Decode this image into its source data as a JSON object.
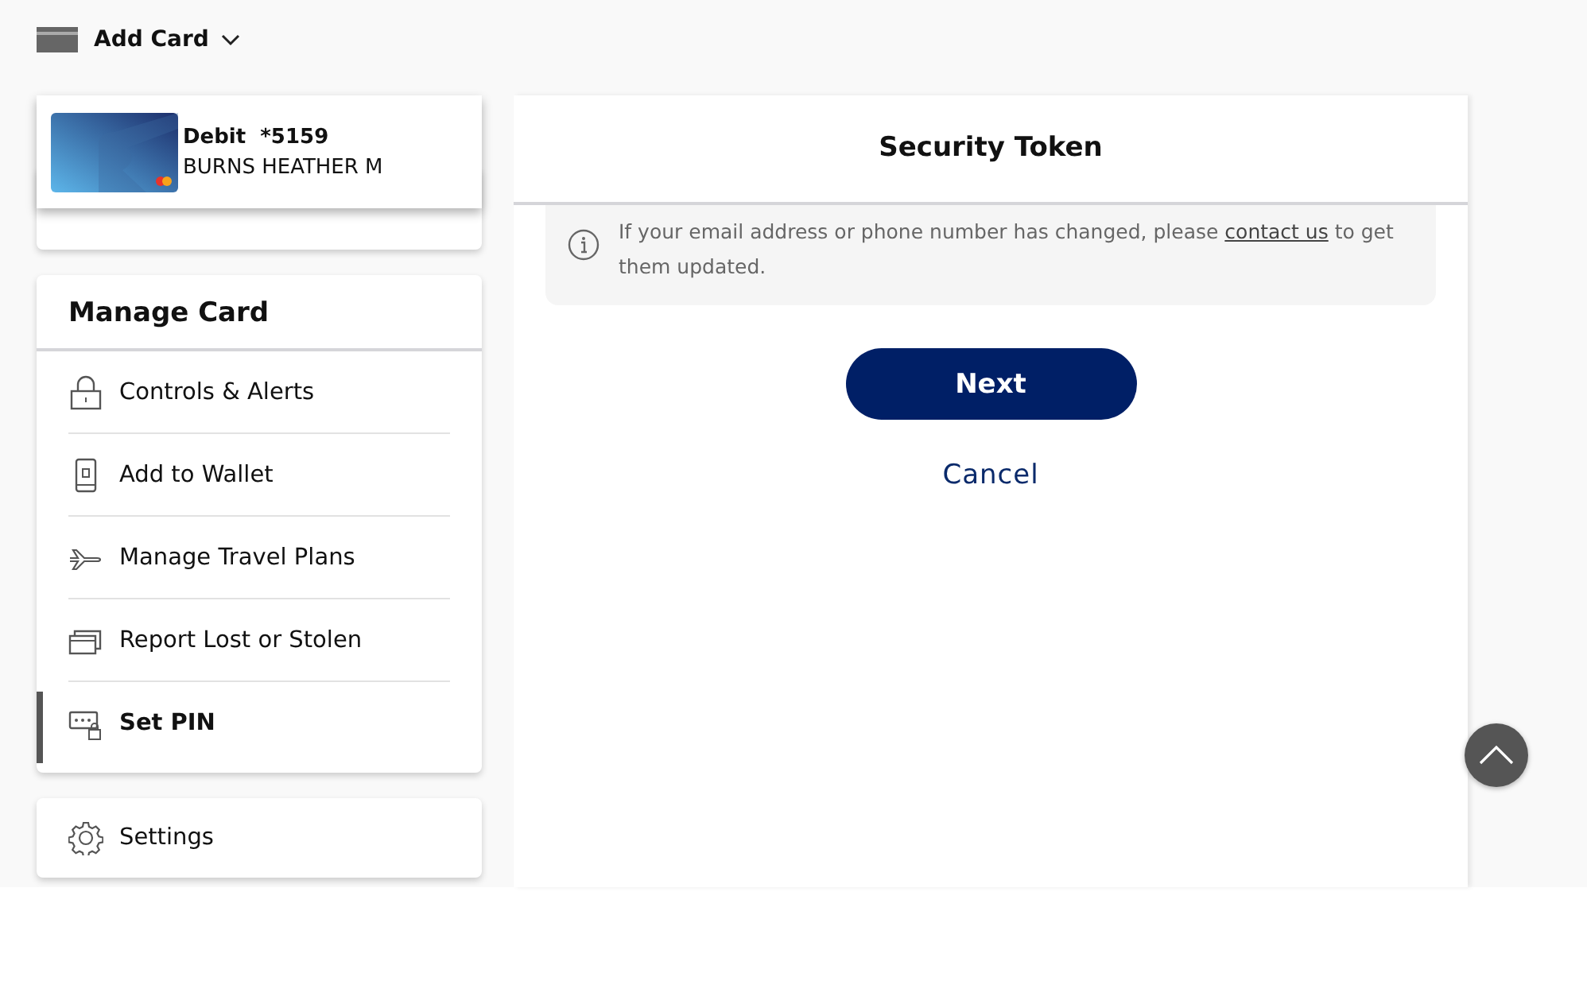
{
  "header": {
    "label": "Add Card"
  },
  "card_popup": {
    "title": "Debit  *5159",
    "holder": "BURNS HEATHER M"
  },
  "manage_card": {
    "title": "Manage Card",
    "items": [
      {
        "label": "Controls & Alerts",
        "kind": "lock",
        "selected": false
      },
      {
        "label": "Add to Wallet",
        "kind": "phone",
        "selected": false
      },
      {
        "label": "Manage Travel Plans",
        "kind": "plane",
        "selected": false
      },
      {
        "label": "Report Lost or Stolen",
        "kind": "cards",
        "selected": false
      },
      {
        "label": "Set PIN",
        "kind": "pin",
        "selected": true
      }
    ]
  },
  "settings": {
    "label": "Settings"
  },
  "panel": {
    "title": "Security Token",
    "info_before": "If your email address or phone number has changed, please ",
    "info_link": "contact us",
    "info_after": " to get them updated.",
    "next": "Next",
    "cancel": "Cancel"
  }
}
